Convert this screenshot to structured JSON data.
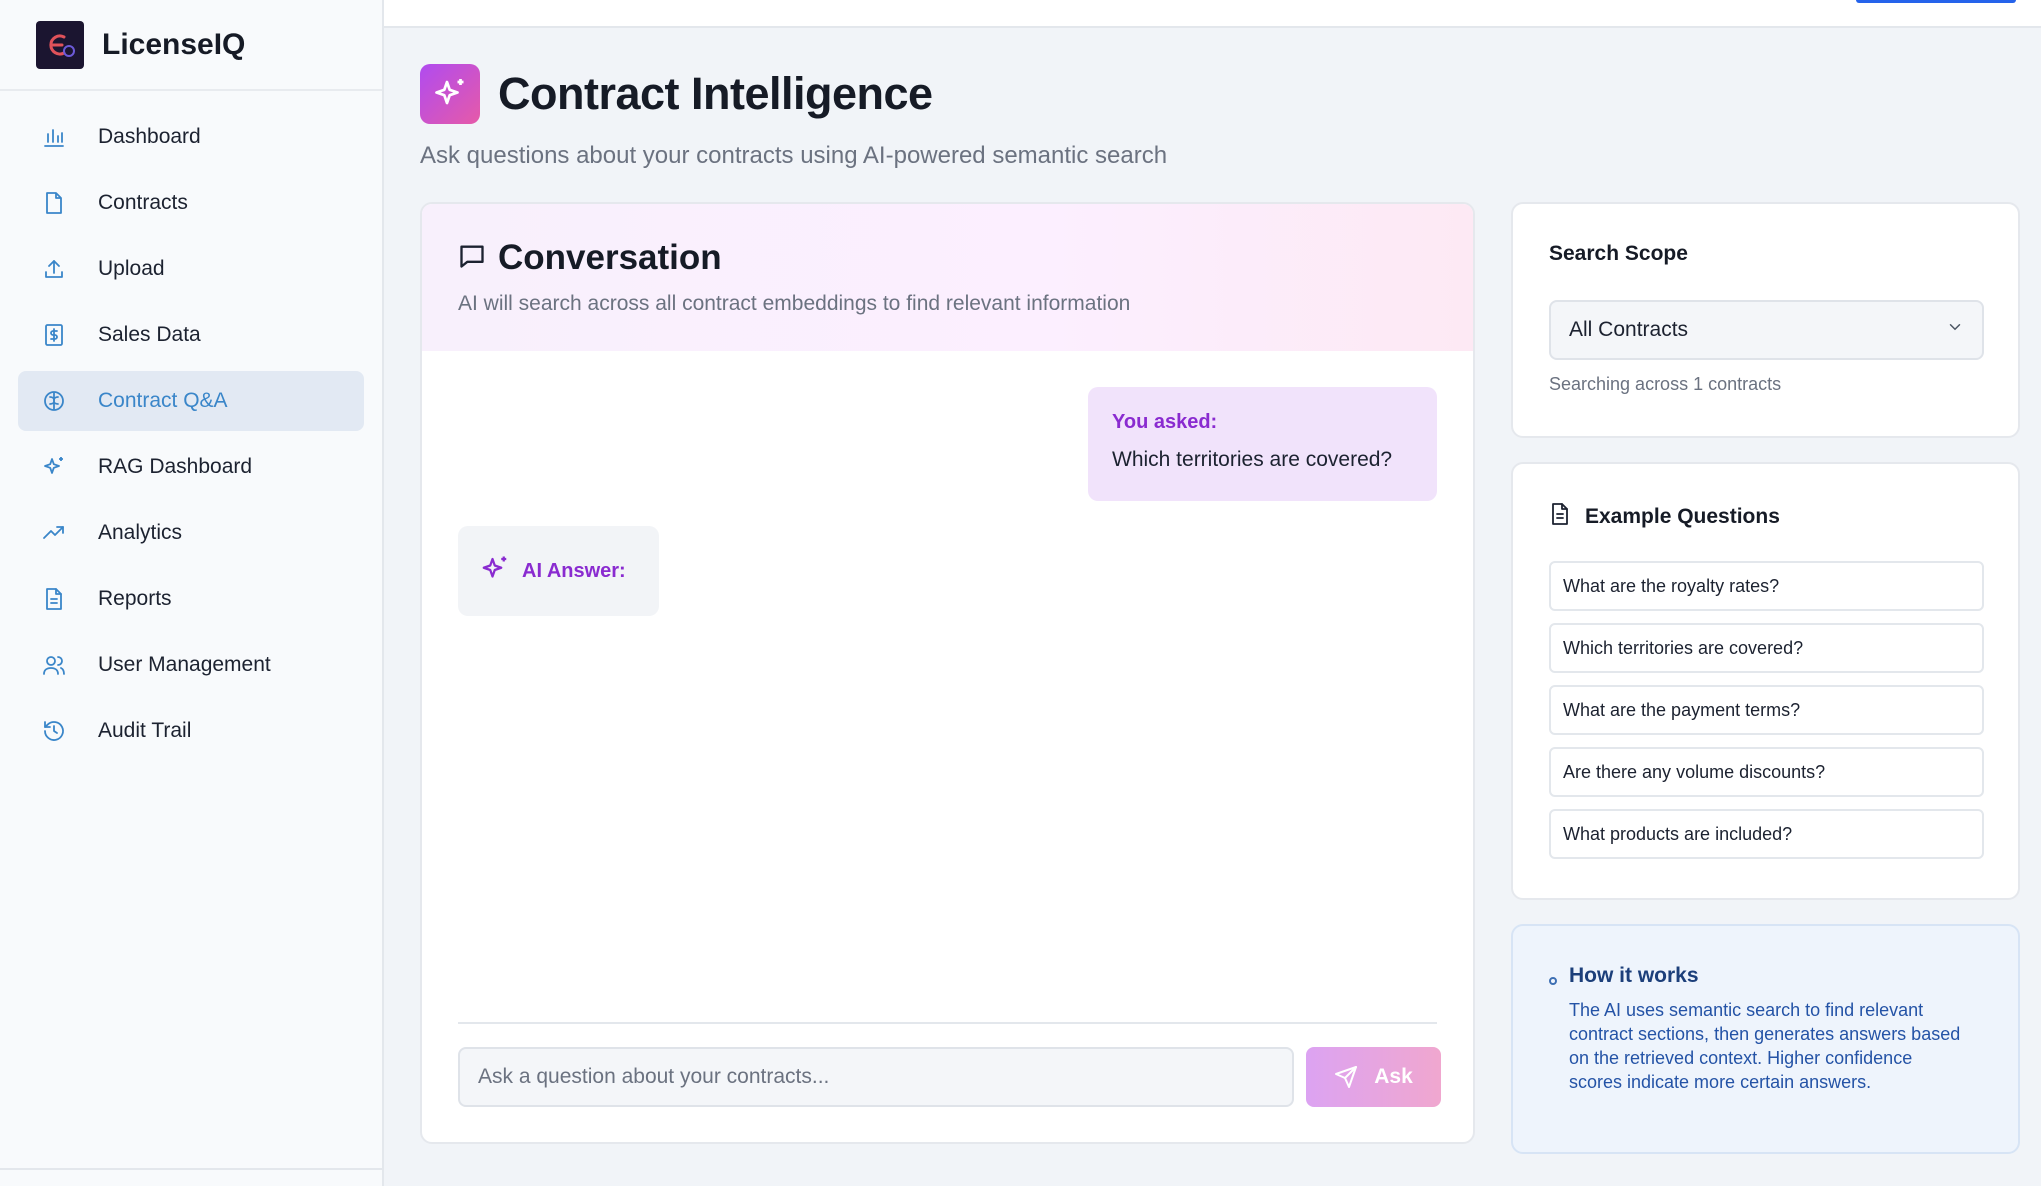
{
  "brand": {
    "name": "LicenseIQ"
  },
  "sidebar": {
    "items": [
      {
        "label": "Dashboard",
        "icon": "bar-chart-icon",
        "active": false
      },
      {
        "label": "Contracts",
        "icon": "file-icon",
        "active": false
      },
      {
        "label": "Upload",
        "icon": "upload-icon",
        "active": false
      },
      {
        "label": "Sales Data",
        "icon": "dollar-receipt-icon",
        "active": false
      },
      {
        "label": "Contract Q&A",
        "icon": "brain-icon",
        "active": true
      },
      {
        "label": "RAG Dashboard",
        "icon": "sparkles-icon",
        "active": false
      },
      {
        "label": "Analytics",
        "icon": "trending-up-icon",
        "active": false
      },
      {
        "label": "Reports",
        "icon": "file-text-icon",
        "active": false
      },
      {
        "label": "User Management",
        "icon": "users-icon",
        "active": false
      },
      {
        "label": "Audit Trail",
        "icon": "history-icon",
        "active": false
      }
    ]
  },
  "header": {
    "title": "Contract Intelligence",
    "subtitle": "Ask questions about your contracts using AI-powered semantic search"
  },
  "conversation": {
    "title": "Conversation",
    "subtitle": "AI will search across all contract embeddings to find relevant information",
    "user_label": "You asked:",
    "user_question": "Which territories are covered?",
    "ai_label": "AI Answer:",
    "input_placeholder": "Ask a question about your contracts...",
    "ask_label": "Ask"
  },
  "search_scope": {
    "title": "Search Scope",
    "selected": "All Contracts",
    "note": "Searching across 1 contracts"
  },
  "examples": {
    "title": "Example Questions",
    "items": [
      "What are the royalty rates?",
      "Which territories are covered?",
      "What are the payment terms?",
      "Are there any volume discounts?",
      "What products are included?"
    ]
  },
  "how_it_works": {
    "title": "How it works",
    "text": "The AI uses semantic search to find relevant contract sections, then generates answers based on the retrieved context. Higher confidence scores indicate more certain answers."
  },
  "colors": {
    "accent": "#3a86c9",
    "brand_gradient_start": "#b04bf0",
    "brand_gradient_end": "#e65aa8",
    "purple_text": "#8a2bd0"
  }
}
